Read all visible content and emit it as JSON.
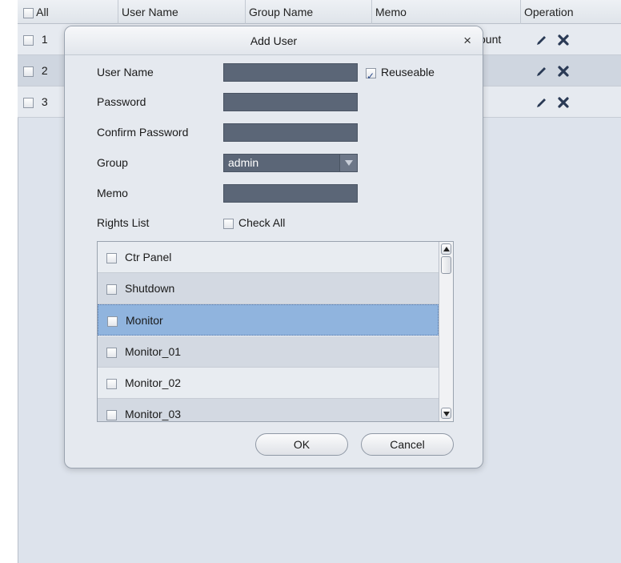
{
  "table": {
    "columns": {
      "all": "All",
      "user_name": "User Name",
      "group_name": "Group Name",
      "memo": "Memo",
      "operation": "Operation"
    },
    "rows": [
      {
        "index": "1",
        "memo_fragment": "ount"
      },
      {
        "index": "2"
      },
      {
        "index": "3"
      }
    ]
  },
  "dialog": {
    "title": "Add User",
    "close_glyph": "×",
    "fields": {
      "user_name": "User Name",
      "password": "Password",
      "confirm_password": "Confirm Password",
      "group": "Group",
      "memo": "Memo",
      "rights_list": "Rights List"
    },
    "reuseable": {
      "label": "Reuseable",
      "checked": true
    },
    "check_all": {
      "label": "Check All",
      "checked": false
    },
    "group_value": "admin",
    "rights": [
      {
        "label": "Ctr Panel"
      },
      {
        "label": "Shutdown"
      },
      {
        "label": "Monitor",
        "selected": true
      },
      {
        "label": "Monitor_01"
      },
      {
        "label": "Monitor_02"
      },
      {
        "label": "Monitor_03"
      }
    ],
    "ok_label": "OK",
    "cancel_label": "Cancel"
  },
  "colors": {
    "field_bg": "#5b6677",
    "selected_row": "#90b4de",
    "background": "#dde3ec"
  },
  "icons": {
    "edit": "pencil-icon",
    "delete": "x-icon",
    "close": "close-icon"
  }
}
